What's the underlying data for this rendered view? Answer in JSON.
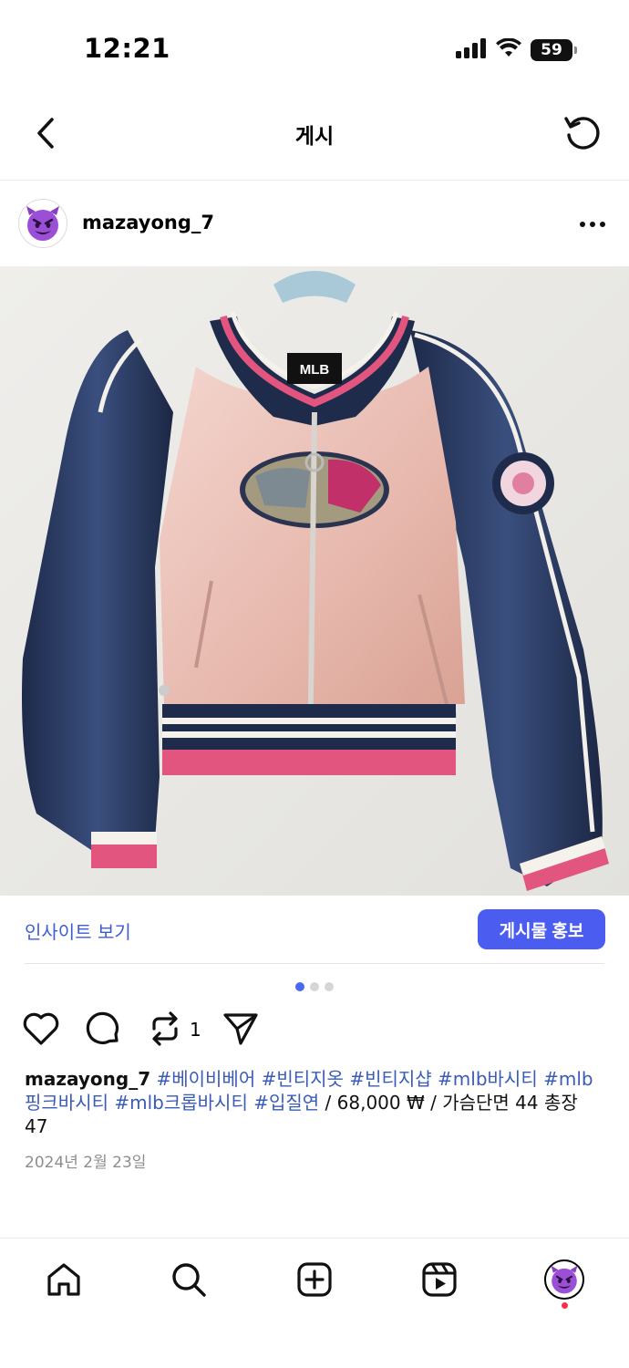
{
  "status": {
    "time": "12:21",
    "battery": "59"
  },
  "nav": {
    "title": "게시"
  },
  "post": {
    "username": "mazayong_7",
    "avatar_icon": "smiling-devil-emoji",
    "image_description": "pink and navy MLB varsity bomber jacket on hanger",
    "insight_label": "인사이트 보기",
    "promote_label": "게시물 홍보",
    "carousel": {
      "count": 3,
      "active_index": 0
    },
    "repost_count": "1",
    "caption": {
      "username": "mazayong_7",
      "tags": [
        "#베이비베어",
        "#빈티지옷",
        "#빈티지샵",
        "#mlb바시티",
        "#mlb핑크바시티",
        "#mlb크롭바시티",
        "#입질연"
      ],
      "text": "/ 68,000 ₩ / 가슴단면 44 총장 47"
    },
    "date": "2024년 2월 23일"
  },
  "colors": {
    "accent": "#4a5df0",
    "link": "#3f5bd8",
    "hashtag": "#3a5bb6",
    "notification": "#ff2d45"
  }
}
